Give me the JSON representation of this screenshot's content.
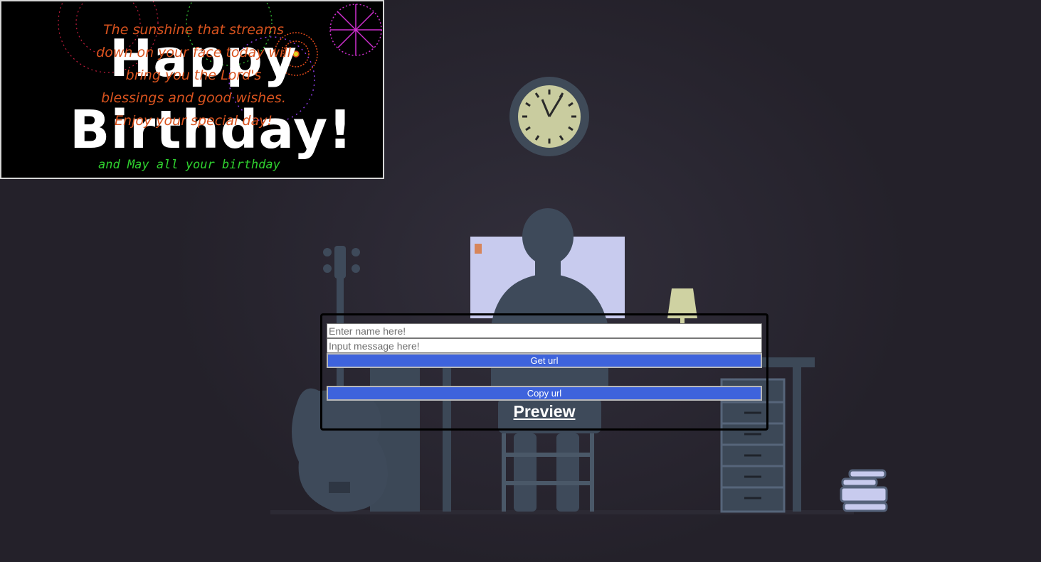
{
  "card": {
    "line1": "Happy",
    "line2": "Birthday!",
    "message": "The sunshine that streams down on your face today will bring you the Lord's blessings and good wishes. Enjoy your special day!",
    "typed_text": "and May all your birthday"
  },
  "form": {
    "name_placeholder": "Enter name here!",
    "message_placeholder": "Input message here!",
    "get_url_label": "Get url",
    "copy_url_label": "Copy url",
    "preview_label": "Preview"
  },
  "colors": {
    "background": "#25222c",
    "button": "#3e63dc",
    "message_text": "#d9531e",
    "typed_text": "#2fd12f"
  }
}
